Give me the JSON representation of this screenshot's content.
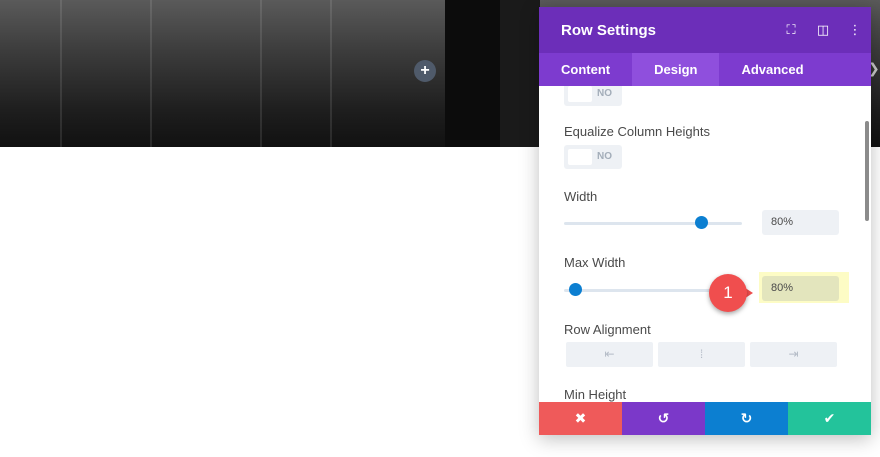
{
  "hero": {
    "add_icon": "+"
  },
  "panel": {
    "title": "Row Settings",
    "icons": {
      "expand": "⛶",
      "sidebar": "◫",
      "more": "⋮"
    },
    "tabs": [
      {
        "label": "Content"
      },
      {
        "label": "Design",
        "active": true
      },
      {
        "label": "Advanced"
      }
    ],
    "toggle_top": {
      "value": "NO"
    },
    "equalize": {
      "label": "Equalize Column Heights",
      "value": "NO"
    },
    "width": {
      "label": "Width",
      "value": "80%",
      "level": 0.77
    },
    "max_width": {
      "label": "Max Width",
      "value": "80%",
      "level": 0.06
    },
    "row_alignment": {
      "label": "Row Alignment",
      "options": [
        "⇤",
        "⁞",
        "⇥"
      ]
    },
    "min_height": {
      "label": "Min Height"
    },
    "footer": {
      "cancel": "✖",
      "undo": "↺",
      "redo": "↻",
      "save": "✔",
      "colors": {
        "cancel": "#ef5a5a",
        "undo": "#7b38c9",
        "redo": "#0c7fd1",
        "save": "#23c39b"
      }
    }
  },
  "callout": {
    "number": "1"
  }
}
